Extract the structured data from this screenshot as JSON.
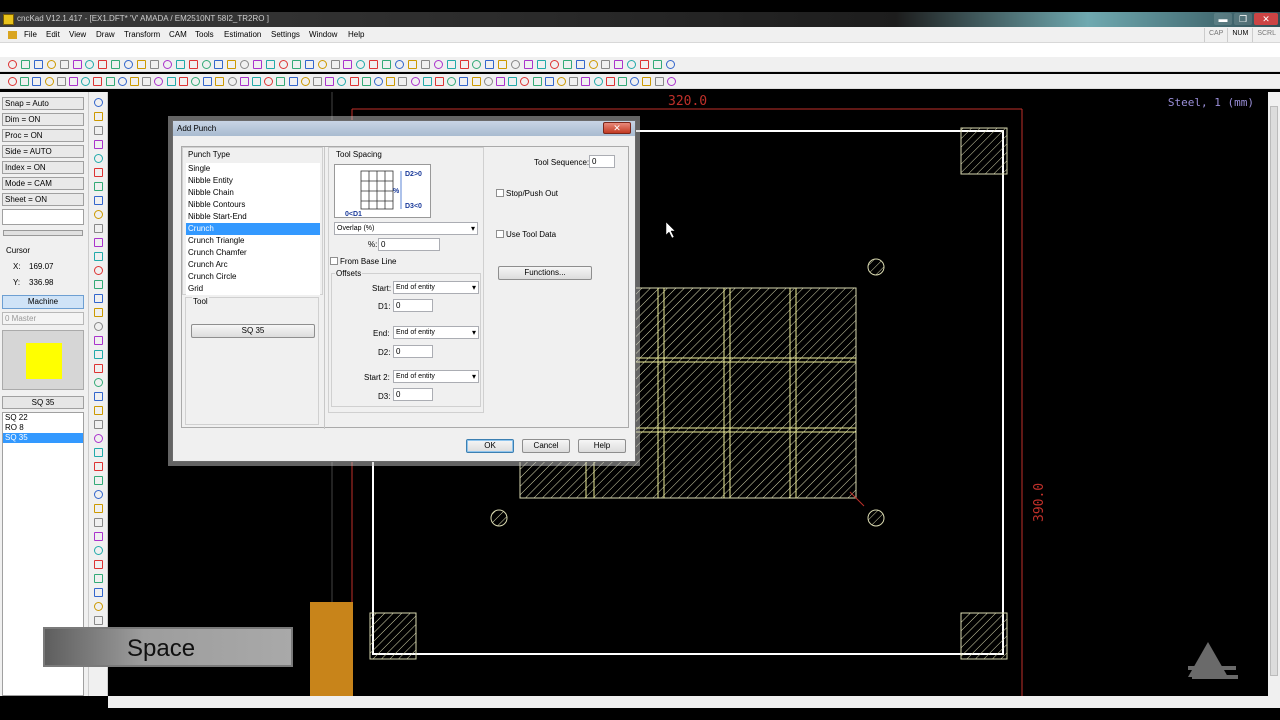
{
  "window": {
    "title": "cncKad V12.1.417 - [EX1.DFT*  'V'  AMADA / EM2510NT  58I2_TR2RO ]",
    "buttons": {
      "minimize": "▬",
      "restore": "❐",
      "close": "✕"
    }
  },
  "menu": {
    "items": [
      "File",
      "Edit",
      "View",
      "Draw",
      "Transform",
      "CAM",
      "Tools",
      "Estimation",
      "Settings",
      "Window",
      "Help"
    ],
    "indicators": [
      {
        "label": "CAP",
        "active": false
      },
      {
        "label": "NUM",
        "active": true
      },
      {
        "label": "SCRL",
        "active": false
      }
    ]
  },
  "left_panel": {
    "toggles": [
      "Snap = Auto",
      "Dim = ON",
      "Proc = ON",
      "Side = AUTO",
      "Index = ON",
      "Mode = CAM",
      "Sheet = ON"
    ],
    "cursor_label": "Cursor",
    "cursor": {
      "x_label": "X:",
      "x": "169.07",
      "y_label": "Y:",
      "y": "336.98"
    },
    "machine_button": "Machine",
    "station_combo": "0 Master",
    "preview_color": "#ffff00",
    "current_tool": "SQ 35",
    "tools": [
      "SQ 22",
      "RO 8",
      "SQ 35"
    ],
    "selected_tool": 2
  },
  "canvas": {
    "material": "Steel, 1 (mm)",
    "dim_width": "320.0",
    "dim_height": "390.0",
    "colors": {
      "part": "#ffffff",
      "hatch": "#d9d9b0",
      "dimension": "#c0302a",
      "clamp": "#c8841a",
      "material_label": "#9a8fd9"
    }
  },
  "overlay": {
    "text": "Space"
  },
  "dialog": {
    "title": "Add Punch",
    "close": "✕",
    "punch_type_title": "Punch Type",
    "punch_types": [
      "Single",
      "Nibble Entity",
      "Nibble Chain",
      "Nibble Contours",
      "Nibble Start-End",
      "Crunch",
      "Crunch Triangle",
      "Crunch Chamfer",
      "Crunch Arc",
      "Crunch Circle",
      "Grid"
    ],
    "selected_punch_type": 5,
    "tool_title": "Tool",
    "tool_button": "SQ 35",
    "tool_spacing_title": "Tool Spacing",
    "diagram_labels": {
      "d2": "D2>0",
      "d3": "D3<0",
      "d1": "0<D1",
      "pct": "%"
    },
    "spacing_mode": "Overlap (%)",
    "percent_label": "%:",
    "percent_value": "0",
    "from_base_line": "From Base Line",
    "offsets_title": "Offsets",
    "start_label": "Start:",
    "start_value": "End of entity",
    "d1_label": "D1:",
    "d1_value": "0",
    "end_label": "End:",
    "end_value": "End of entity",
    "d2_label": "D2:",
    "d2_value": "0",
    "start2_label": "Start 2:",
    "start2_value": "End of entity",
    "d3_label": "D3:",
    "d3_value": "0",
    "tool_sequence_label": "Tool Sequence:",
    "tool_sequence_value": "0",
    "stop_push_out": "Stop/Push Out",
    "use_tool_data": "Use Tool Data",
    "functions_button": "Functions...",
    "ok": "OK",
    "cancel": "Cancel",
    "help": "Help"
  }
}
